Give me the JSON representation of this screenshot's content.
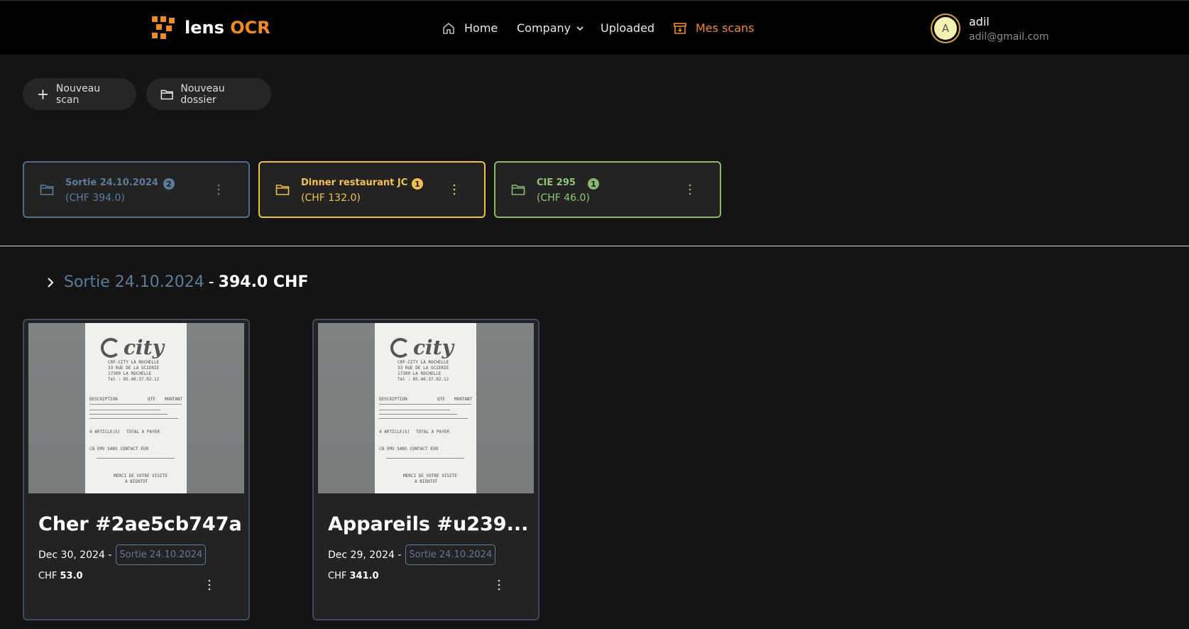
{
  "app": {
    "logo_text": "lens",
    "logo_accent": "OCR"
  },
  "nav": {
    "home": "Home",
    "company": "Company",
    "uploaded": "Uploaded",
    "mes_scans": "Mes scans"
  },
  "user": {
    "initial": "A",
    "name": "adil",
    "email": "adil@gmail.com"
  },
  "actions": {
    "new_scan": "Nouveau scan",
    "new_folder": "Nouveau dossier"
  },
  "folders": [
    {
      "name": "Sortie 24.10.2024",
      "total": "(CHF 394.0)",
      "count": "2",
      "color": "#5c7c9b"
    },
    {
      "name": "Dinner restaurant JC",
      "total": "(CHF 132.0)",
      "count": "1",
      "color": "#f0bf45"
    },
    {
      "name": "CIE 295",
      "total": "(CHF 46.0)",
      "count": "1",
      "color": "#86b96b"
    }
  ],
  "section": {
    "folder_name": "Sortie 24.10.2024",
    "separator": "-",
    "total": "394.0 CHF"
  },
  "scans": [
    {
      "title": "Cher #2ae5cb747a",
      "date": "Dec 30, 2024 -",
      "folder_tag": "Sortie 24.10.2024",
      "currency": "CHF",
      "amount": "53.0"
    },
    {
      "title": "Appareils #u239...",
      "date": "Dec 29, 2024 -",
      "folder_tag": "Sortie 24.10.2024",
      "currency": "CHF",
      "amount": "341.0"
    }
  ],
  "receipt": {
    "brand": "city",
    "lines": [
      "CRF-CITY LA ROCHELLE",
      "33 RUE DE LA SCIERIE",
      "17300   LA ROCHELLE",
      "Tel : 05.46.37.02.12",
      "DESCRIPTION",
      "QTE",
      "MONTANT",
      "4 ARTICLE(S)",
      "TOTAL A PAYER",
      "CB EMV SANS CONTACT  EUR",
      "MERCI DE VOTRE VISITE",
      "A BIENTOT"
    ]
  }
}
